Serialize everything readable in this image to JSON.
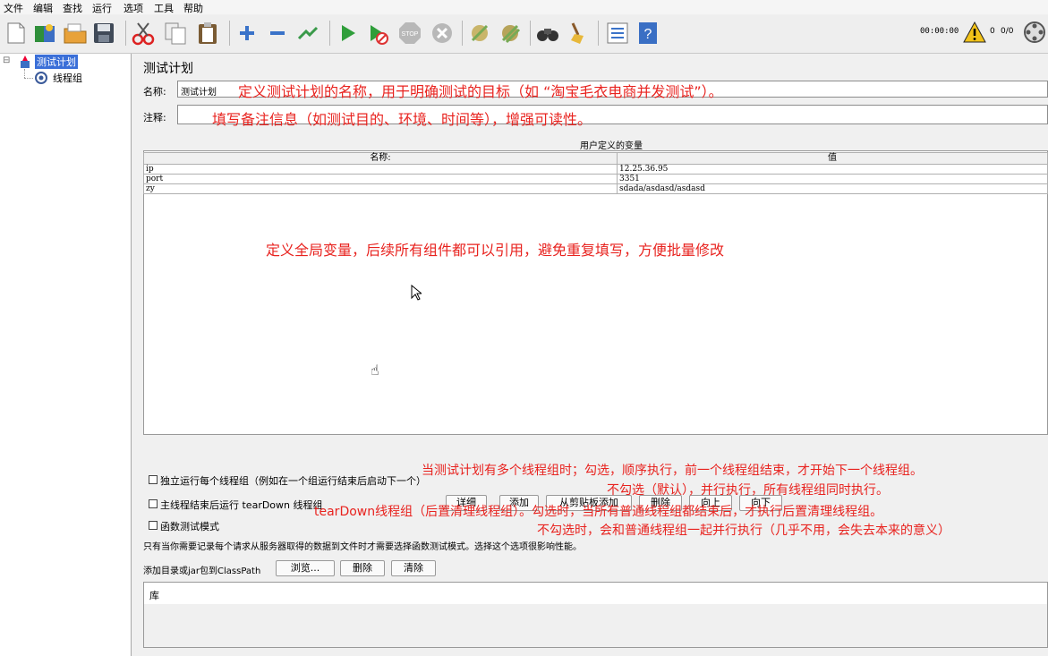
{
  "menu": [
    "文件",
    "编辑",
    "查找",
    "运行",
    "选项",
    "工具",
    "帮助"
  ],
  "toolbar": {
    "timer": "00:00:00",
    "warning_count": "0",
    "threads": "0/0"
  },
  "tree": {
    "root": "测试计划",
    "child": "线程组"
  },
  "panel": {
    "title": "测试计划",
    "name_label": "名称:",
    "name_value": "测试计划",
    "comment_label": "注释:",
    "vars_title": "用户定义的变量",
    "col_name": "名称:",
    "col_value": "值",
    "rows": [
      {
        "name": "ip",
        "value": "12.25.36.95"
      },
      {
        "name": "port",
        "value": "3351"
      },
      {
        "name": "zy",
        "value": "sdada/asdasd/asdasd"
      }
    ],
    "buttons": [
      "详细",
      "添加",
      "从剪贴板添加",
      "删除",
      "向上",
      "向下"
    ],
    "cb_serial": "独立运行每个线程组（例如在一个组运行结束后启动下一个）",
    "cb_teardown": "主线程结束后运行 tearDown 线程组",
    "cb_functional": "函数测试模式",
    "functional_note": "只有当你需要记录每个请求从服务器取得的数据到文件时才需要选择函数测试模式。选择这个选项很影响性能。",
    "classpath_label": "添加目录或jar包到ClassPath",
    "browse": "浏览...",
    "delete": "删除",
    "clear": "清除",
    "lib_label": "库"
  },
  "annotations": {
    "name_note": "定义测试计划的名称，用于明确测试的目标（如 “淘宝毛衣电商并发测试”）。",
    "comment_note": "填写备注信息（如测试目的、环境、时间等），增强可读性。",
    "vars_note": "定义全局变量，后续所有组件都可以引用，避免重复填写，方便批量修改",
    "serial_note_1": "当测试计划有多个线程组时；勾选，顺序执行，前一个线程组结束，才开始下一个线程组。",
    "serial_note_2": "不勾选（默认），并行执行，所有线程组同时执行。",
    "teardown_note_1": "tearDown线程组（后置清理线程组）。勾选时，当所有普通线程组都结束后，才执行后置清理线程组。",
    "teardown_note_2": "不勾选时，会和普通线程组一起并行执行（几乎不用，会失去本来的意义）"
  },
  "colors": {
    "annotation": "#e8231f",
    "selection": "#3a6fd8"
  }
}
